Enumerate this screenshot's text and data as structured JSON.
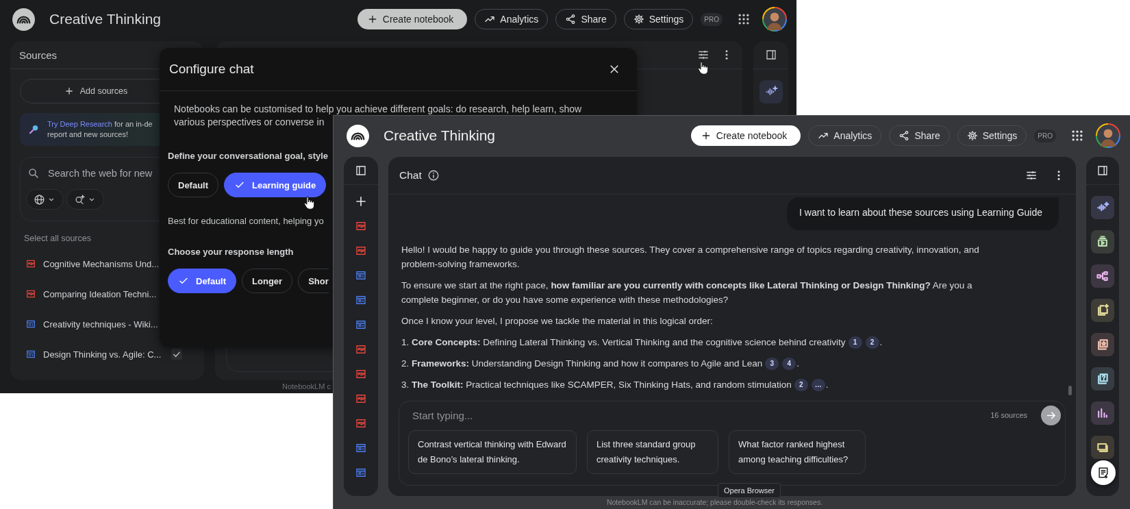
{
  "back_window": {
    "header": {
      "title": "Creative Thinking",
      "buttons": [
        {
          "kind": "create",
          "label": "Create notebook"
        },
        {
          "kind": "analytics",
          "label": "Analytics"
        },
        {
          "kind": "share",
          "label": "Share"
        },
        {
          "kind": "settings",
          "label": "Settings"
        }
      ],
      "badge": "PRO"
    },
    "sources": {
      "title": "Sources",
      "add_button": "Add sources",
      "promo": {
        "link": "Try Deep Research",
        "text": "for an in-de",
        "line_2": "report and new sources!"
      },
      "search": {
        "placeholder": "Search the web for new"
      },
      "select_all": "Select all sources",
      "items": [
        {
          "kind": "pdf",
          "name": "Cognitive Mechanisms Und..."
        },
        {
          "kind": "pdf",
          "name": "Comparing Ideation Techni..."
        },
        {
          "kind": "web",
          "name": "Creativity techniques - Wiki..."
        },
        {
          "kind": "web",
          "name": "Design Thinking vs. Agile: C...",
          "checked": true
        }
      ]
    },
    "dialog": {
      "title": "Configure chat",
      "description": [
        "Notebooks can be customised to help you achieve different goals: do research, help learn, show",
        "various perspectives or converse in"
      ],
      "goal_label": "Define your conversational goal, style",
      "goal_options": [
        {
          "label": "Default",
          "selected": false
        },
        {
          "label": "Learning guide",
          "selected": true
        }
      ],
      "goal_hint": "Best for educational content, helping yo",
      "length_label": "Choose your response length",
      "length_options": [
        {
          "label": "Default",
          "selected": true
        },
        {
          "label": "Longer",
          "selected": false
        },
        {
          "label": "Shor",
          "selected": false
        }
      ]
    },
    "footer": "NotebookLM c"
  },
  "front_window": {
    "header": {
      "title": "Creative Thinking",
      "buttons": [
        {
          "kind": "create",
          "label": "Create notebook"
        },
        {
          "kind": "analytics",
          "label": "Analytics"
        },
        {
          "kind": "share",
          "label": "Share"
        },
        {
          "kind": "settings",
          "label": "Settings"
        }
      ],
      "badge": "PRO"
    },
    "rail_sources": [
      {
        "kind": "pdf"
      },
      {
        "kind": "pdf"
      },
      {
        "kind": "web"
      },
      {
        "kind": "web"
      },
      {
        "kind": "web"
      },
      {
        "kind": "pdf"
      },
      {
        "kind": "pdf"
      },
      {
        "kind": "pdf"
      },
      {
        "kind": "pdf"
      },
      {
        "kind": "web"
      },
      {
        "kind": "web"
      }
    ],
    "chat": {
      "title": "Chat",
      "user_message": "I want to learn about these sources using Learning Guide",
      "response": [
        {
          "text": "Hello! I would be happy to guide you through these sources. They cover a comprehensive range of topics regarding creativity, innovation, and problem-solving frameworks."
        },
        {
          "text": "To ensure we start at the right pace, **how familiar are you currently with concepts like Lateral Thinking or Design Thinking?** Are you a complete beginner, or do you have some experience with these methodologies?"
        },
        {
          "text": "Once I know your level, I propose we tackle the material in this logical order:"
        },
        {
          "text": "1. **Core Concepts:** Defining Lateral Thinking vs. Vertical Thinking and the cognitive science behind creativity",
          "citations": [
            "1",
            "2"
          ],
          "after": "."
        },
        {
          "text": "2. **Frameworks:** Understanding Design Thinking and how it compares to Agile and Lean",
          "citations": [
            "3",
            "4"
          ],
          "after": "."
        },
        {
          "text": "3. **The Toolkit:** Practical techniques like SCAMPER, Six Thinking Hats, and random stimulation",
          "citations": [
            "2",
            "…"
          ],
          "after": "."
        }
      ],
      "input": {
        "placeholder": "Start typing...",
        "source_count": "16 sources"
      },
      "suggestions": [
        "Contrast vertical thinking with Edward de Bono’s lateral thinking.",
        "List three standard group creativity techniques.",
        "What factor ranked highest among teaching difficulties?"
      ]
    },
    "studio_tiles": [
      {
        "kind": "audio",
        "color": "#aab6ff"
      },
      {
        "kind": "video",
        "color": "#b9dfb0"
      },
      {
        "kind": "mindmap",
        "color": "#e6b3ea"
      },
      {
        "kind": "reports",
        "color": "#e6dc9c"
      },
      {
        "kind": "flashcards",
        "color": "#f0bfae"
      },
      {
        "kind": "quiz",
        "color": "#addfee"
      },
      {
        "kind": "infographic",
        "color": "#e3b4f2"
      },
      {
        "kind": "slides",
        "color": "#e2d38e"
      }
    ],
    "tooltip": "Opera Browser",
    "footer": "NotebookLM can be inaccurate; please double-check its responses."
  }
}
